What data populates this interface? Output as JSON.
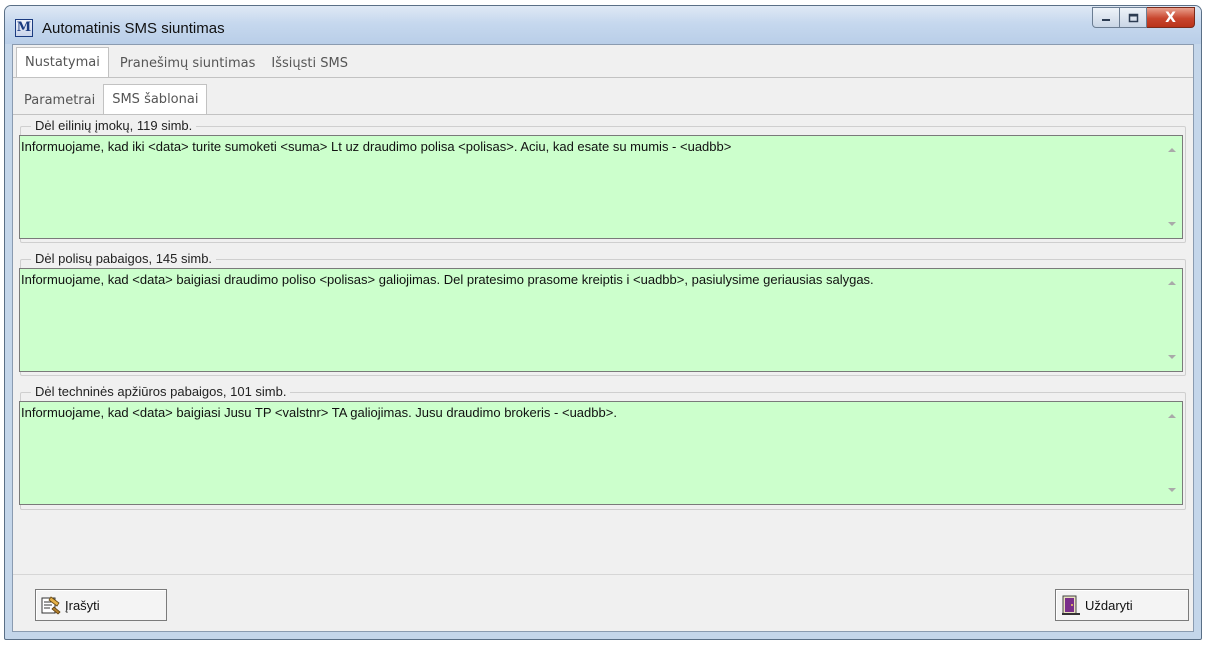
{
  "window": {
    "title": "Automatinis SMS siuntimas",
    "app_icon_letter": "M",
    "close_glyph": "X"
  },
  "tabs": [
    "Nustatymai",
    "Pranešimų siuntimas",
    "Išsiųsti SMS"
  ],
  "subtabs": [
    "Parametrai",
    "SMS šablonai"
  ],
  "templates": [
    {
      "label": "Dėl eilinių įmokų, 119 simb.",
      "text": "Informuojame, kad iki <data> turite sumoketi <suma> Lt uz draudimo polisa <polisas>. Aciu, kad esate su mumis - <uadbb>"
    },
    {
      "label": "Dėl polisų pabaigos, 145 simb.",
      "text": "Informuojame, kad <data> baigiasi draudimo poliso <polisas> galiojimas. Del pratesimo prasome kreiptis i <uadbb>, pasiulysime geriausias salygas."
    },
    {
      "label": "Dėl techninės apžiūros pabaigos, 101 simb.",
      "text": "Informuojame, kad <data> baigiasi Jusu TP <valstnr> TA  galiojimas. Jusu draudimo brokeris - <uadbb>."
    }
  ],
  "buttons": {
    "save_label": "Įrašyti",
    "close_label": "Uždaryti"
  },
  "colors": {
    "memo_background": "#ccffcc",
    "window_frame": "#c4d6ea"
  }
}
